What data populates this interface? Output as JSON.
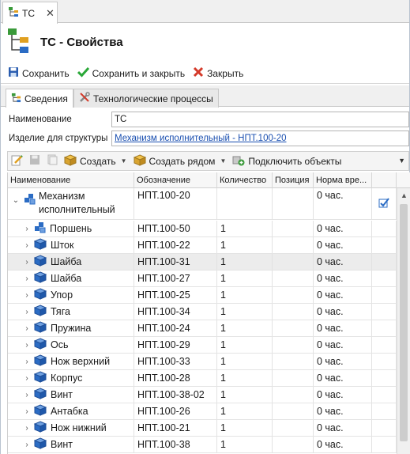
{
  "doc_tab": {
    "label": "ТС"
  },
  "header": {
    "title": "ТС - Свойства"
  },
  "actions": {
    "save": "Сохранить",
    "save_close": "Сохранить и закрыть",
    "close": "Закрыть"
  },
  "tabs": [
    {
      "label": "Сведения"
    },
    {
      "label": "Технологические процессы"
    }
  ],
  "form": {
    "name_label": "Наименование",
    "name_value": "ТС",
    "product_label": "Изделие для структуры",
    "product_value": "Механизм исполнительный - НПТ.100-20"
  },
  "grid_toolbar": {
    "create": "Создать",
    "create_near": "Создать рядом",
    "connect": "Подключить объекты"
  },
  "columns": [
    "Наименование",
    "Обозначение",
    "Количество",
    "Позиция",
    "Норма вре..."
  ],
  "root_row": {
    "name": "Механизм исполнительный",
    "designation": "НПТ.100-20",
    "qty": "",
    "pos": "",
    "norm": "0 час."
  },
  "rows": [
    {
      "name": "Поршень",
      "designation": "НПТ.100-50",
      "qty": "1",
      "norm": "0 час.",
      "type": "assembly"
    },
    {
      "name": "Шток",
      "designation": "НПТ.100-22",
      "qty": "1",
      "norm": "0 час.",
      "type": "part"
    },
    {
      "name": "Шайба",
      "designation": "НПТ.100-31",
      "qty": "1",
      "norm": "0 час.",
      "type": "part"
    },
    {
      "name": "Шайба",
      "designation": "НПТ.100-27",
      "qty": "1",
      "norm": "0 час.",
      "type": "part"
    },
    {
      "name": "Упор",
      "designation": "НПТ.100-25",
      "qty": "1",
      "norm": "0 час.",
      "type": "part"
    },
    {
      "name": "Тяга",
      "designation": "НПТ.100-34",
      "qty": "1",
      "norm": "0 час.",
      "type": "part"
    },
    {
      "name": "Пружина",
      "designation": "НПТ.100-24",
      "qty": "1",
      "norm": "0 час.",
      "type": "part"
    },
    {
      "name": "Ось",
      "designation": "НПТ.100-29",
      "qty": "1",
      "norm": "0 час.",
      "type": "part"
    },
    {
      "name": "Нож верхний",
      "designation": "НПТ.100-33",
      "qty": "1",
      "norm": "0 час.",
      "type": "part"
    },
    {
      "name": "Корпус",
      "designation": "НПТ.100-28",
      "qty": "1",
      "norm": "0 час.",
      "type": "part"
    },
    {
      "name": "Винт",
      "designation": "НПТ.100-38-02",
      "qty": "1",
      "norm": "0 час.",
      "type": "part"
    },
    {
      "name": "Антабка",
      "designation": "НПТ.100-26",
      "qty": "1",
      "norm": "0 час.",
      "type": "part"
    },
    {
      "name": "Нож нижний",
      "designation": "НПТ.100-21",
      "qty": "1",
      "norm": "0 час.",
      "type": "part"
    },
    {
      "name": "Винт",
      "designation": "НПТ.100-38",
      "qty": "1",
      "norm": "0 час.",
      "type": "part"
    }
  ],
  "selected_row": 2,
  "colors": {
    "link": "#1a4fb0",
    "save_icon": "#2a5db0",
    "check_icon": "#2aa838",
    "close_icon": "#d43a2a",
    "part_icon": "#2b6cc4"
  }
}
